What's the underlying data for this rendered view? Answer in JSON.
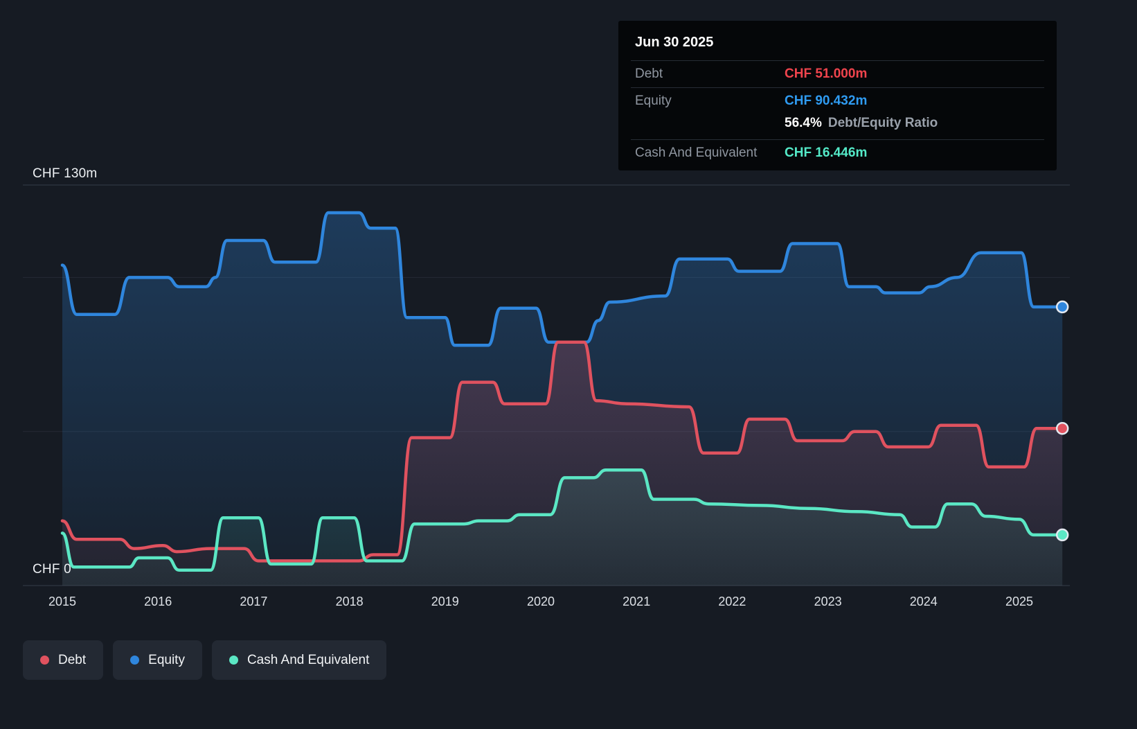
{
  "tooltip": {
    "date": "Jun 30 2025",
    "debt": {
      "label": "Debt",
      "value": "CHF 51.000m",
      "color": "#f0444d"
    },
    "equity": {
      "label": "Equity",
      "value": "CHF 90.432m",
      "color": "#2f9bf1"
    },
    "ratio": {
      "value": "56.4%",
      "label": "Debt/Equity Ratio"
    },
    "cash": {
      "label": "Cash And Equivalent",
      "value": "CHF 16.446m",
      "color": "#54eac8"
    }
  },
  "legend": {
    "items": [
      {
        "label": "Debt",
        "color": "#e0525f"
      },
      {
        "label": "Equity",
        "color": "#2f86dd"
      },
      {
        "label": "Cash And Equivalent",
        "color": "#5be7c4"
      }
    ]
  },
  "chart_data": {
    "type": "area",
    "unit": "CHF millions",
    "x_range": [
      2015,
      2025.5
    ],
    "x_ticks": [
      "2015",
      "2016",
      "2017",
      "2018",
      "2019",
      "2020",
      "2021",
      "2022",
      "2023",
      "2024",
      "2025"
    ],
    "y_axis": {
      "min": 0,
      "max": 130,
      "gridlines": [
        0,
        50,
        100,
        130
      ],
      "top_label": "CHF 130m",
      "bottom_label": "CHF 0"
    },
    "legend_position": "bottom-left",
    "grid": true,
    "series": [
      {
        "name": "Debt",
        "color": "#e0525f",
        "points": [
          [
            2015.0,
            21
          ],
          [
            2015.15,
            15
          ],
          [
            2015.6,
            15
          ],
          [
            2015.75,
            12
          ],
          [
            2016.05,
            13
          ],
          [
            2016.2,
            11
          ],
          [
            2016.55,
            12
          ],
          [
            2016.9,
            12
          ],
          [
            2017.05,
            8
          ],
          [
            2018.1,
            8
          ],
          [
            2018.25,
            10
          ],
          [
            2018.5,
            10
          ],
          [
            2018.65,
            48
          ],
          [
            2019.05,
            48
          ],
          [
            2019.18,
            66
          ],
          [
            2019.5,
            66
          ],
          [
            2019.62,
            59
          ],
          [
            2020.05,
            59
          ],
          [
            2020.18,
            79
          ],
          [
            2020.45,
            79
          ],
          [
            2020.58,
            60
          ],
          [
            2020.9,
            59
          ],
          [
            2021.55,
            58
          ],
          [
            2021.7,
            43
          ],
          [
            2022.05,
            43
          ],
          [
            2022.18,
            54
          ],
          [
            2022.55,
            54
          ],
          [
            2022.68,
            47
          ],
          [
            2023.15,
            47
          ],
          [
            2023.28,
            50
          ],
          [
            2023.5,
            50
          ],
          [
            2023.63,
            45
          ],
          [
            2024.05,
            45
          ],
          [
            2024.18,
            52
          ],
          [
            2024.55,
            52
          ],
          [
            2024.68,
            38.5
          ],
          [
            2025.05,
            38.5
          ],
          [
            2025.18,
            51
          ],
          [
            2025.45,
            51.0
          ]
        ]
      },
      {
        "name": "Equity",
        "color": "#2f86dd",
        "points": [
          [
            2015.0,
            104
          ],
          [
            2015.15,
            88
          ],
          [
            2015.55,
            88
          ],
          [
            2015.7,
            100
          ],
          [
            2016.1,
            100
          ],
          [
            2016.22,
            97
          ],
          [
            2016.5,
            97
          ],
          [
            2016.6,
            100
          ],
          [
            2016.72,
            112
          ],
          [
            2017.1,
            112
          ],
          [
            2017.22,
            105
          ],
          [
            2017.65,
            105
          ],
          [
            2017.78,
            121
          ],
          [
            2018.1,
            121
          ],
          [
            2018.22,
            116
          ],
          [
            2018.48,
            116
          ],
          [
            2018.6,
            87
          ],
          [
            2019.0,
            87
          ],
          [
            2019.1,
            78
          ],
          [
            2019.45,
            78
          ],
          [
            2019.58,
            90
          ],
          [
            2019.95,
            90
          ],
          [
            2020.08,
            79
          ],
          [
            2020.48,
            79
          ],
          [
            2020.6,
            86
          ],
          [
            2020.72,
            92
          ],
          [
            2021.3,
            94
          ],
          [
            2021.45,
            106
          ],
          [
            2021.95,
            106
          ],
          [
            2022.07,
            102
          ],
          [
            2022.5,
            102
          ],
          [
            2022.63,
            111
          ],
          [
            2023.1,
            111
          ],
          [
            2023.22,
            97
          ],
          [
            2023.5,
            97
          ],
          [
            2023.6,
            95
          ],
          [
            2023.95,
            95
          ],
          [
            2024.07,
            97
          ],
          [
            2024.35,
            100
          ],
          [
            2024.6,
            108
          ],
          [
            2025.02,
            108
          ],
          [
            2025.15,
            90.432
          ],
          [
            2025.45,
            90.432
          ]
        ]
      },
      {
        "name": "Cash And Equivalent",
        "color": "#5be7c4",
        "points": [
          [
            2015.0,
            17
          ],
          [
            2015.12,
            6
          ],
          [
            2015.7,
            6
          ],
          [
            2015.8,
            9
          ],
          [
            2016.1,
            9
          ],
          [
            2016.22,
            5
          ],
          [
            2016.55,
            5
          ],
          [
            2016.68,
            22
          ],
          [
            2017.05,
            22
          ],
          [
            2017.18,
            7
          ],
          [
            2017.6,
            7
          ],
          [
            2017.72,
            22
          ],
          [
            2018.05,
            22
          ],
          [
            2018.18,
            8
          ],
          [
            2018.55,
            8
          ],
          [
            2018.68,
            20
          ],
          [
            2019.2,
            20
          ],
          [
            2019.35,
            21
          ],
          [
            2019.65,
            21
          ],
          [
            2019.78,
            23
          ],
          [
            2020.1,
            23
          ],
          [
            2020.25,
            35
          ],
          [
            2020.55,
            35
          ],
          [
            2020.68,
            37.5
          ],
          [
            2021.05,
            37.5
          ],
          [
            2021.18,
            28
          ],
          [
            2021.6,
            28
          ],
          [
            2021.75,
            26.5
          ],
          [
            2022.3,
            26
          ],
          [
            2022.8,
            25
          ],
          [
            2023.3,
            24
          ],
          [
            2023.75,
            23
          ],
          [
            2023.88,
            19
          ],
          [
            2024.12,
            19
          ],
          [
            2024.25,
            26.5
          ],
          [
            2024.5,
            26.5
          ],
          [
            2024.65,
            22.5
          ],
          [
            2025.0,
            21.5
          ],
          [
            2025.15,
            16.446
          ],
          [
            2025.45,
            16.446
          ]
        ]
      }
    ]
  }
}
